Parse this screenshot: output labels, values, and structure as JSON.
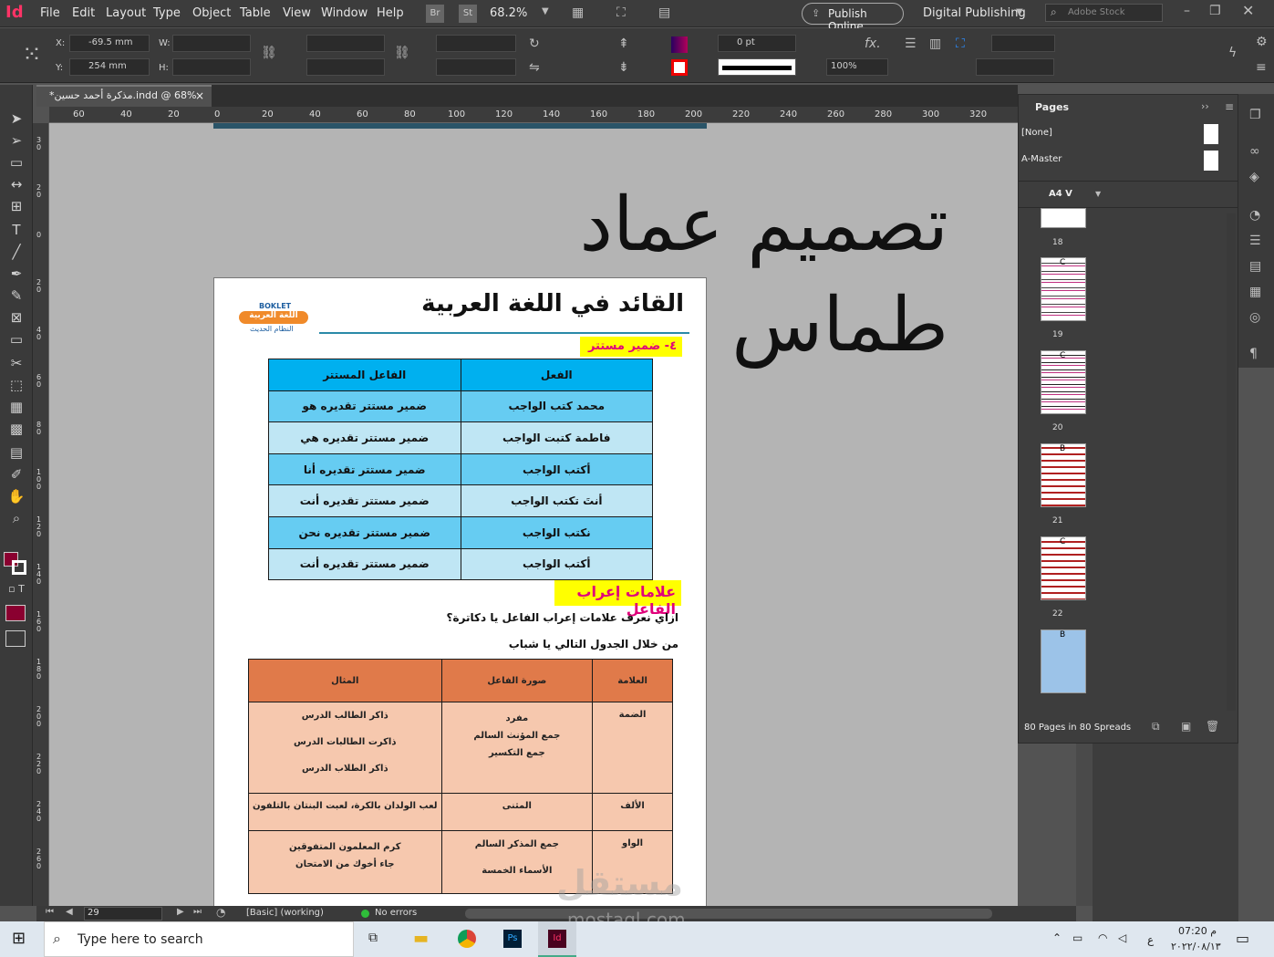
{
  "app": {
    "logo": "Id",
    "accent": "#ff3366"
  },
  "menu": [
    "File",
    "Edit",
    "Layout",
    "Type",
    "Object",
    "Table",
    "View",
    "Window",
    "Help"
  ],
  "topbar": {
    "br": "Br",
    "st": "St",
    "zoom": "68.2%",
    "publish": "Publish Online",
    "workspace": "Digital Publishing",
    "search_placeholder": "Adobe Stock"
  },
  "control": {
    "x_label": "X:",
    "x_value": "-69.5 mm",
    "y_label": "Y:",
    "y_value": "254 mm",
    "w_label": "W:",
    "h_label": "H:",
    "stroke": "0 pt",
    "opacity": "100%"
  },
  "doc_tab": {
    "title": "*مذكرة أحمد حسين.indd @ 68%",
    "close": "×"
  },
  "ruler": {
    "h": [
      "60",
      "40",
      "20",
      "0",
      "20",
      "40",
      "60",
      "80",
      "100",
      "120",
      "140",
      "160",
      "180",
      "200",
      "220",
      "240",
      "260",
      "280",
      "300",
      "320"
    ],
    "v": [
      "3\n0",
      "2\n0",
      "0",
      "2\n0",
      "4\n0",
      "6\n0",
      "8\n0",
      "1\n0\n0",
      "1\n2\n0",
      "1\n4\n0",
      "1\n6\n0",
      "1\n8\n0",
      "2\n0\n0",
      "2\n2\n0",
      "2\n4\n0",
      "2\n6\n0"
    ]
  },
  "canvas": {
    "big_title": "تصميم عماد طماس",
    "book_title": "القائد في اللغة العربية",
    "boklet": {
      "line1": "BOKLET",
      "line2": "اللغة العربية",
      "line3": "النظام الحديث"
    },
    "section_tag": "٤- ضمير مستتر",
    "table1": {
      "headers": [
        "الفعل",
        "الفاعل المستتر"
      ],
      "rows": [
        [
          "محمد كتب الواجب",
          "ضمير مستتر تقديره هو"
        ],
        [
          "فاطمة كتبت الواجب",
          "ضمير مستتر تقديره هي"
        ],
        [
          "أكتب الواجب",
          "ضمير مستتر تقديره أنا"
        ],
        [
          "أنتَ تكتب الواجب",
          "ضمير مستتر تقديره أنت"
        ],
        [
          "نكتب الواجب",
          "ضمير مستتر تقديره نحن"
        ],
        [
          "أكتب الواجب",
          "ضمير مستتر تقديره أنت"
        ]
      ]
    },
    "heading2": "علامات إعراب الفاعل",
    "q1": "ازاي نعرف علامات إعراب الفاعل يا دكاترة؟",
    "q2": "من خلال الجدول التالي يا شباب",
    "table2": {
      "headers": [
        "العلامة",
        "صورة الفاعل",
        "المثال"
      ],
      "rows": [
        [
          "الضمة",
          "مفرد\nجمع المؤنث السالم\nجمع التكسير",
          "ذاكر الطالب الدرس\n\nذاكرت الطالبات الدرس\n\nذاكر الطلاب الدرس"
        ],
        [
          "الألف",
          "المثنى",
          "لعب الولدان بالكرة، لعبت البنتان بالتلفون"
        ],
        [
          "الواو",
          "جمع المذكر السالم\n\nالأسماء الخمسة",
          "كرم المعلمون المتفوقين\nجاء أخوك من الامتحان"
        ]
      ]
    }
  },
  "pages_panel": {
    "title": "Pages",
    "masters": [
      "[None]",
      "A-Master"
    ],
    "size": "A4 V",
    "thumbs": [
      {
        "label": "18",
        "master": ""
      },
      {
        "label": "19",
        "master": "C"
      },
      {
        "label": "20",
        "master": "C"
      },
      {
        "label": "21",
        "master": "B"
      },
      {
        "label": "22",
        "master": "C"
      },
      {
        "label": "",
        "master": "B"
      }
    ],
    "footer": "80 Pages in 80 Spreads"
  },
  "status": {
    "page": "29",
    "style": "[Basic] (working)",
    "errors": "No errors"
  },
  "taskbar": {
    "search": "Type here to search",
    "time": "07:20 م",
    "date": "٢٠٢٢/٠٨/١٣",
    "lang": "ع"
  },
  "watermark": {
    "ar": "مستقل",
    "en": "mostaql.com"
  }
}
